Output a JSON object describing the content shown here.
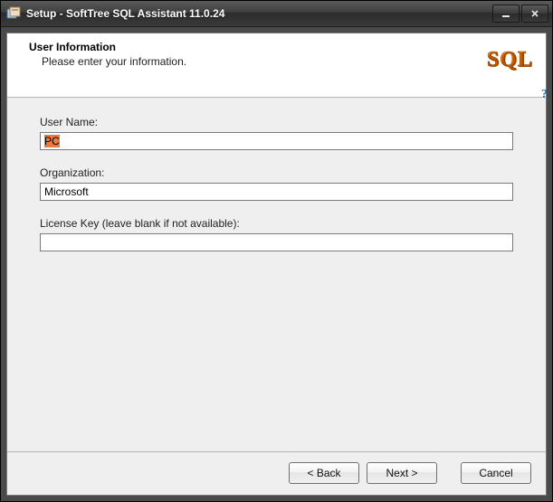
{
  "titlebar": {
    "title": "Setup - SoftTree SQL Assistant 11.0.24"
  },
  "header": {
    "heading": "User Information",
    "sub": "Please enter your information.",
    "logo_text": "SQL"
  },
  "fields": {
    "user_name": {
      "label": "User Name:",
      "value": "PC"
    },
    "organization": {
      "label": "Organization:",
      "value": "Microsoft"
    },
    "license_key": {
      "label": "License Key (leave blank if not available):",
      "value": ""
    }
  },
  "buttons": {
    "back": "< Back",
    "next": "Next >",
    "cancel": "Cancel"
  }
}
